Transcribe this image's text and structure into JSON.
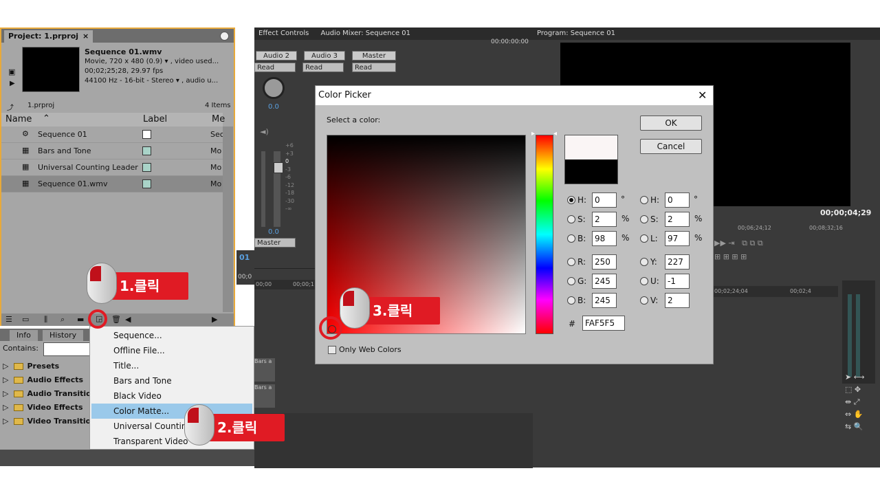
{
  "project": {
    "tab": "Project: 1.prproj",
    "clip_name": "Sequence 01.wmv",
    "clip_line1": "Movie, 720 x 480 (0.9)",
    "clip_line1b": ", video used...",
    "clip_line2": "00;02;25;28, 29.97 fps",
    "clip_line3": "44100 Hz - 16-bit - Stereo",
    "clip_line3b": ", audio u...",
    "bin_name": "1.prproj",
    "item_count": "4 Items",
    "columns": [
      "Name",
      "Label",
      "Me"
    ],
    "rows": [
      {
        "name": "Sequence 01",
        "media": "Sec",
        "color": "#ffffff"
      },
      {
        "name": "Bars and Tone",
        "media": "Mo",
        "color": "#a9d3c8"
      },
      {
        "name": "Universal Counting Leader",
        "media": "Mo",
        "color": "#a9d3c8"
      },
      {
        "name": "Sequence 01.wmv",
        "media": "Mo",
        "color": "#a9d3c8"
      }
    ]
  },
  "lower_left": {
    "tabs": [
      "Info",
      "History"
    ],
    "contains_label": "Contains:",
    "tree": [
      "Presets",
      "Audio Effects",
      "Audio Transitio",
      "Video Effects",
      "Video Transitio"
    ]
  },
  "mixer": {
    "tabs": [
      "Effect Controls",
      "Audio Mixer: Sequence 01"
    ],
    "timecode": "00:00:00:00",
    "channels": [
      "Audio 2",
      "Audio 3",
      "Master"
    ],
    "mode": "Read",
    "level": "0.0",
    "level2": "0.0",
    "master_dd": "Master",
    "db_marks": [
      "+6",
      "+3",
      "0",
      "-3",
      "-6",
      "-12",
      "-18",
      "-30",
      "-∞"
    ]
  },
  "program": {
    "tab": "Program: Sequence 01",
    "timecode": "00;00;04;29",
    "ruler": [
      "00;06;24;12",
      "00;08;32;16"
    ],
    "ruler2": [
      "00;02;24;04",
      "00;02;4"
    ],
    "seq": "01",
    "tc_left": "00;0"
  },
  "timeline": {
    "start": "00;00",
    "mark": "00;00;1",
    "clip": "Bars a",
    "clip2": "Bars a"
  },
  "context_menu": {
    "items": [
      "Sequence...",
      "Offline File...",
      "Title...",
      "Bars and Tone",
      "Black Video",
      "Color Matte...",
      "Universal Counting",
      "Transparent Video"
    ],
    "highlighted": "Color Matte..."
  },
  "color_picker": {
    "title": "Color Picker",
    "prompt": "Select a color:",
    "ok": "OK",
    "cancel": "Cancel",
    "web_only": "Only Web Colors",
    "hsb": {
      "h_label": "H:",
      "s_label": "S:",
      "b_label": "B:",
      "h": "0",
      "s": "2",
      "b": "98",
      "h_unit": "°",
      "s_unit": "%",
      "b_unit": "%"
    },
    "hsl": {
      "h_label": "H:",
      "s_label": "S:",
      "l_label": "L:",
      "h": "0",
      "s": "2",
      "l": "97",
      "h_unit": "°",
      "s_unit": "%",
      "l_unit": "%"
    },
    "rgb": {
      "r_label": "R:",
      "g_label": "G:",
      "b_label": "B:",
      "r": "250",
      "g": "245",
      "b": "245"
    },
    "yuv": {
      "y_label": "Y:",
      "u_label": "U:",
      "v_label": "V:",
      "y": "227",
      "u": "-1",
      "v": "2"
    },
    "hash": "#",
    "hex": "FAF5F5",
    "new_color": "#faf5f5",
    "old_color": "#000000"
  },
  "annotations": {
    "step1": "1.클릭",
    "step2": "2.클릭",
    "step3": "3.클릭",
    "color": "#e01b24"
  }
}
